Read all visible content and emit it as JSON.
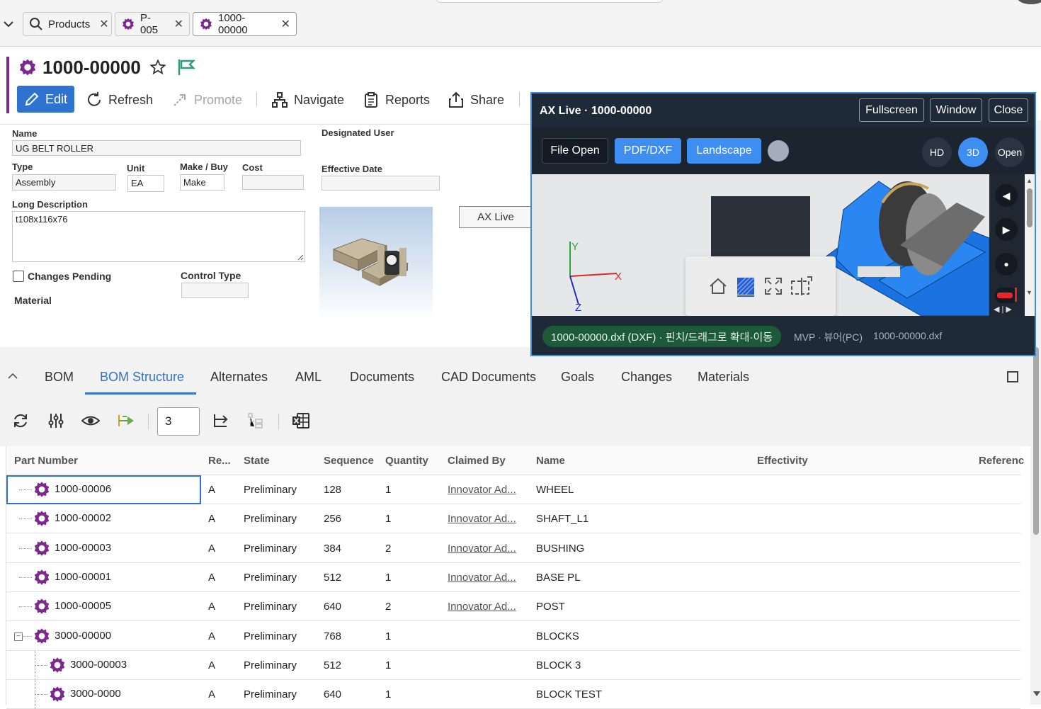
{
  "tabs": [
    {
      "label": "Products",
      "icon": "search-icon"
    },
    {
      "label": "P-005",
      "icon": "gear-icon"
    },
    {
      "label": "1000-00000",
      "icon": "gear-icon",
      "active": true
    }
  ],
  "header": {
    "title": "1000-00000",
    "toolbar": {
      "edit": "Edit",
      "refresh": "Refresh",
      "promote": "Promote",
      "navigate": "Navigate",
      "reports": "Reports",
      "share": "Share"
    }
  },
  "form": {
    "name_label": "Name",
    "name_value": "UG BELT ROLLER",
    "designated_user_label": "Designated User",
    "type_label": "Type",
    "type_value": "Assembly",
    "unit_label": "Unit",
    "unit_value": "EA",
    "make_buy_label": "Make / Buy",
    "make_buy_value": "Make",
    "cost_label": "Cost",
    "cost_value": "",
    "effective_date_label": "Effective Date",
    "effective_date_value": "",
    "long_description_label": "Long Description",
    "long_description_value": "t108x116x76",
    "changes_pending_label": "Changes Pending",
    "control_type_label": "Control Type",
    "control_type_value": "",
    "material_label": "Material",
    "ax_live_button": "AX Live"
  },
  "bottom_tabs": [
    "BOM",
    "BOM Structure",
    "Alternates",
    "AML",
    "Documents",
    "CAD Documents",
    "Goals",
    "Changes",
    "Materials"
  ],
  "active_bottom_tab": "BOM Structure",
  "grid_toolbar": {
    "levels_value": "3"
  },
  "grid": {
    "columns": [
      "Part Number",
      "Re...",
      "State",
      "Sequence",
      "Quantity",
      "Claimed By",
      "Name",
      "Effectivity",
      "Referenc"
    ],
    "rows": [
      {
        "part": "1000-00006",
        "rev": "A",
        "state": "Preliminary",
        "seq": "128",
        "qty": "1",
        "claimed": "Innovator Ad...",
        "name": "WHEEL"
      },
      {
        "part": "1000-00002",
        "rev": "A",
        "state": "Preliminary",
        "seq": "256",
        "qty": "1",
        "claimed": "Innovator Ad...",
        "name": "SHAFT_L1"
      },
      {
        "part": "1000-00003",
        "rev": "A",
        "state": "Preliminary",
        "seq": "384",
        "qty": "2",
        "claimed": "Innovator Ad...",
        "name": "BUSHING"
      },
      {
        "part": "1000-00001",
        "rev": "A",
        "state": "Preliminary",
        "seq": "512",
        "qty": "1",
        "claimed": "Innovator Ad...",
        "name": "BASE PL"
      },
      {
        "part": "1000-00005",
        "rev": "A",
        "state": "Preliminary",
        "seq": "640",
        "qty": "2",
        "claimed": "Innovator Ad...",
        "name": "POST"
      },
      {
        "part": "3000-00000",
        "rev": "A",
        "state": "Preliminary",
        "seq": "768",
        "qty": "1",
        "claimed": "",
        "name": "BLOCKS"
      },
      {
        "part": "3000-00003",
        "rev": "A",
        "state": "Preliminary",
        "seq": "512",
        "qty": "1",
        "claimed": "",
        "name": "BLOCK 3"
      },
      {
        "part": "3000-0000",
        "rev": "A",
        "state": "Preliminary",
        "seq": "640",
        "qty": "1",
        "claimed": "",
        "name": "BLOCK TEST"
      }
    ]
  },
  "ax_panel": {
    "title": "AX Live · 1000-00000",
    "fullscreen": "Fullscreen",
    "window": "Window",
    "close": "Close",
    "file_open": "File Open",
    "pdf_dxf": "PDF/DXF",
    "landscape": "Landscape",
    "hd": "HD",
    "three_d": "3D",
    "open": "Open",
    "axis_x": "X",
    "axis_y": "Y",
    "axis_z": "Z",
    "status_pill": "1000-00000.dxf (DXF) · 핀치/드래그로 확대·이동",
    "mode": "MVP · 뷰어(PC)",
    "filename": "1000-00000.dxf"
  },
  "colors": {
    "accent_blue": "#2f73d0",
    "purple": "#7b2a8c",
    "flag_green": "#2a9d7a",
    "panel_bg": "#1f2a38",
    "panel_border": "#3d8bd9",
    "part_blue": "#1a73e0"
  }
}
